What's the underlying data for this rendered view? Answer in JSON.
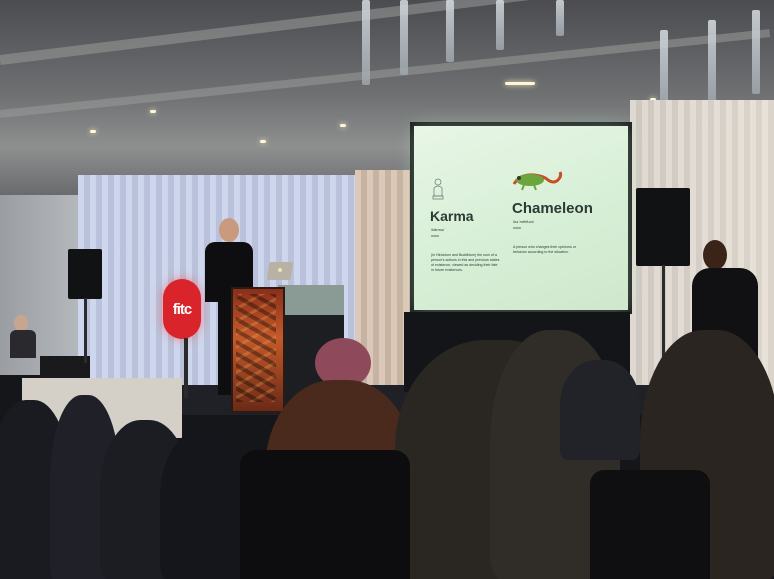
{
  "logo": {
    "text": "fitc",
    "color": "#d8242a"
  },
  "slide": {
    "background": "#dff2dd",
    "left_word": "Karma",
    "left_pron": "/kärmə/",
    "left_pos": "noun",
    "left_def": "(in Hinduism and Buddhism) the sum of a person's actions in this and previous states of existence, viewed as deciding their fate in future existences.",
    "left_icon": "buddha-statue-icon",
    "right_word": "Chameleon",
    "right_pron": "/kəˈmēlēən/",
    "right_pos": "noun",
    "right_def": "A person who changes their opinions or behavior according to the situation.",
    "right_icon": "chameleon-icon"
  },
  "colors": {
    "stage_light": "#c9d2ec",
    "podium": "#c45a2a"
  }
}
